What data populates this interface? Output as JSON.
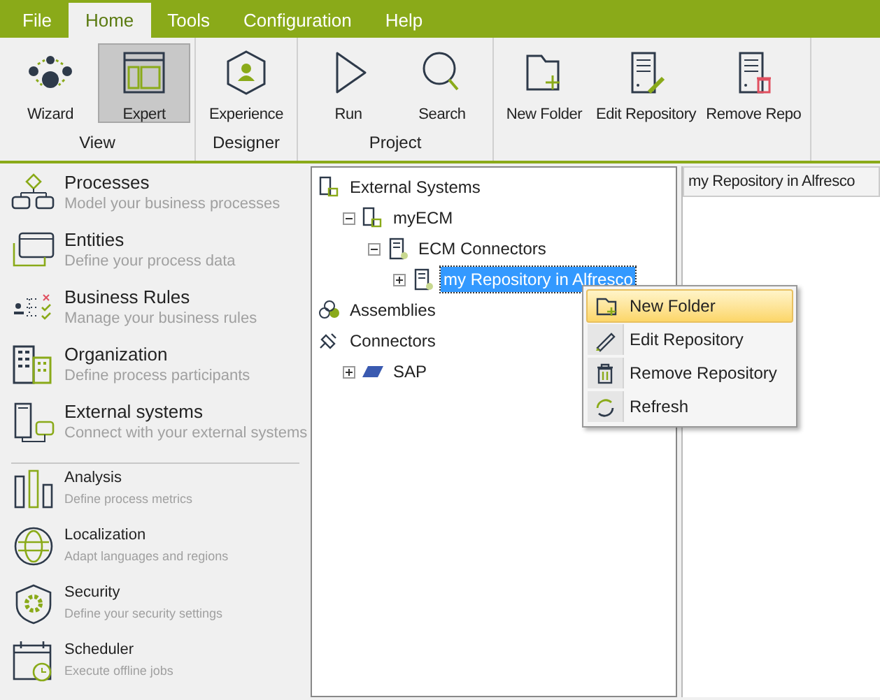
{
  "menu_tabs": [
    {
      "label": "File",
      "selected": false
    },
    {
      "label": "Home",
      "selected": true
    },
    {
      "label": "Tools",
      "selected": false
    },
    {
      "label": "Configuration",
      "selected": false
    },
    {
      "label": "Help",
      "selected": false
    }
  ],
  "ribbon_groups": [
    {
      "label": "View",
      "buttons": [
        {
          "label": "Wizard",
          "selected": false
        },
        {
          "label": "Expert",
          "selected": true
        }
      ]
    },
    {
      "label": "Designer",
      "buttons": [
        {
          "label": "Experience",
          "selected": false
        }
      ]
    },
    {
      "label": "Project",
      "buttons": [
        {
          "label": "Run",
          "selected": false
        },
        {
          "label": "Search",
          "selected": false
        }
      ]
    },
    {
      "buttons": [
        {
          "label": "New Folder",
          "selected": false
        },
        {
          "label": "Edit Repository",
          "selected": false
        },
        {
          "label": "Remove Repo",
          "selected": false
        }
      ]
    }
  ],
  "sidebar": {
    "groups": [
      {
        "kind": "large",
        "items": [
          {
            "title": "Processes",
            "description": "Model your business processes"
          },
          {
            "title": "Entities",
            "description": "Define your process data"
          },
          {
            "title": "Business Rules",
            "description": "Manage your business rules"
          },
          {
            "title": "Organization",
            "description": "Define process participants"
          },
          {
            "title": "External systems",
            "description": "Connect with your external systems"
          }
        ]
      },
      {
        "kind": "small",
        "items": [
          {
            "title": "Analysis",
            "description": "Define process metrics"
          },
          {
            "title": "Localization",
            "description": "Adapt languages and regions"
          },
          {
            "title": "Security",
            "description": "Define your security settings"
          },
          {
            "title": "Scheduler",
            "description": "Execute offline jobs"
          }
        ]
      }
    ]
  },
  "tree": [
    {
      "label": "External Systems",
      "selected": false,
      "children": [
        {
          "label": "myECM",
          "selected": false,
          "expanded": true,
          "children": [
            {
              "label": "ECM Connectors",
              "selected": false,
              "expanded": true,
              "children": [
                {
                  "label": "my Repository in Alfresco",
                  "selected": true,
                  "expanded": false
                }
              ]
            }
          ]
        }
      ]
    },
    {
      "label": "Assemblies",
      "selected": false
    },
    {
      "label": "Connectors",
      "selected": false,
      "children": [
        {
          "label": "SAP",
          "selected": false,
          "expanded": false
        }
      ]
    }
  ],
  "document_tab": {
    "label": "my Repository in Alfresco"
  },
  "context_menu": [
    {
      "label": "New Folder",
      "selected": true
    },
    {
      "label": "Edit Repository",
      "selected": false
    },
    {
      "label": "Remove Repository",
      "selected": false
    },
    {
      "label": "Refresh",
      "selected": false
    }
  ]
}
